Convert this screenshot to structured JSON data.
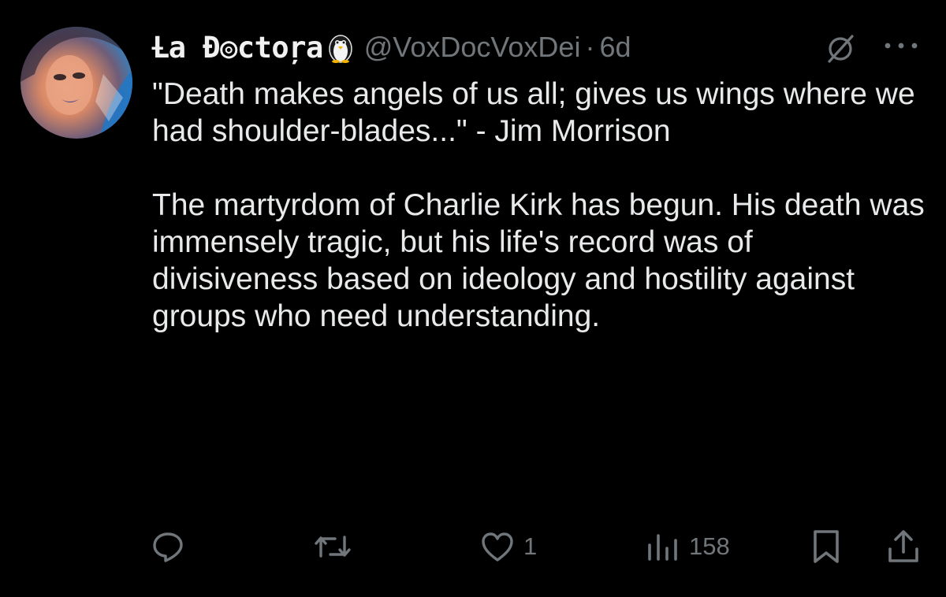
{
  "tweet": {
    "display_name": "Ƚa Ɖ◎ctoŗa",
    "handle": "@VoxDocVoxDei",
    "separator": "·",
    "time": "6d",
    "paragraphs": [
      "\"Death makes angels of us all; gives us wings where we had shoulder-blades...\" - Jim Morrison",
      "The martyrdom of Charlie Kirk has begun. His death was immensely tragic, but his life's record was of divisiveness based on ideology and hostility against groups who need understanding."
    ]
  },
  "actions": {
    "reply_icon": "reply-icon",
    "repost_icon": "repost-icon",
    "like_icon": "heart-icon",
    "like_count": "1",
    "views_icon": "analytics-icon",
    "views_count": "158",
    "bookmark_icon": "bookmark-icon",
    "share_icon": "share-icon"
  },
  "icons": {
    "avatar": "avatar",
    "badge": "penguin-icon",
    "grok": "grok-icon",
    "more": "more-icon"
  },
  "colors": {
    "background": "#000000",
    "text": "#e7e9ea",
    "secondary": "#71767b"
  }
}
